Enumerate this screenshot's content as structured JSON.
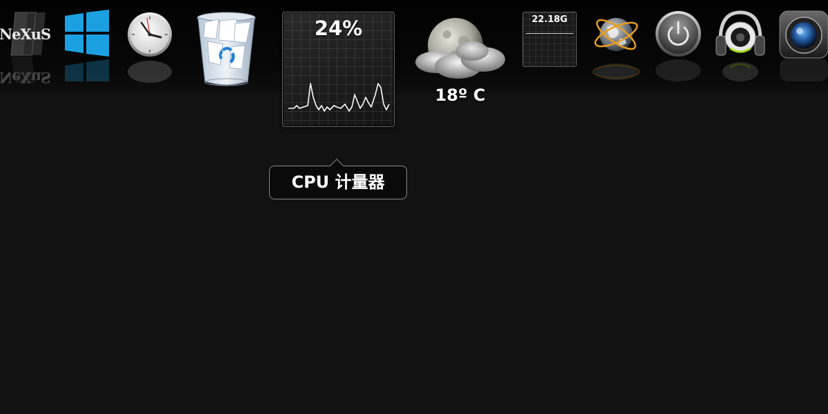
{
  "dock": {
    "items": [
      {
        "id": "nexus",
        "icon": "nexus-logo-icon",
        "label": "NeXuS"
      },
      {
        "id": "windows",
        "icon": "windows-logo-icon"
      },
      {
        "id": "clock",
        "icon": "clock-icon"
      },
      {
        "id": "recycle-bin",
        "icon": "recycle-bin-icon"
      },
      {
        "id": "cpu-meter",
        "icon": "cpu-meter-widget"
      },
      {
        "id": "weather",
        "icon": "weather-moon-cloud-icon"
      },
      {
        "id": "disk-space",
        "icon": "disk-meter-widget"
      },
      {
        "id": "globe",
        "icon": "globe-icon"
      },
      {
        "id": "power",
        "icon": "power-icon"
      },
      {
        "id": "music",
        "icon": "headphones-speaker-icon"
      },
      {
        "id": "camera",
        "icon": "camera-lens-icon"
      }
    ]
  },
  "cpu_widget": {
    "percent_label": "24%",
    "value": 24
  },
  "weather": {
    "temperature": "18º C"
  },
  "disk_widget": {
    "value": "22.18G"
  },
  "tooltip": {
    "text": "CPU 计量器"
  },
  "colors": {
    "background": "#121212",
    "dock": "#050505",
    "windows_blue": "#1ba1e2",
    "globe_orbit": "#e8a020"
  }
}
